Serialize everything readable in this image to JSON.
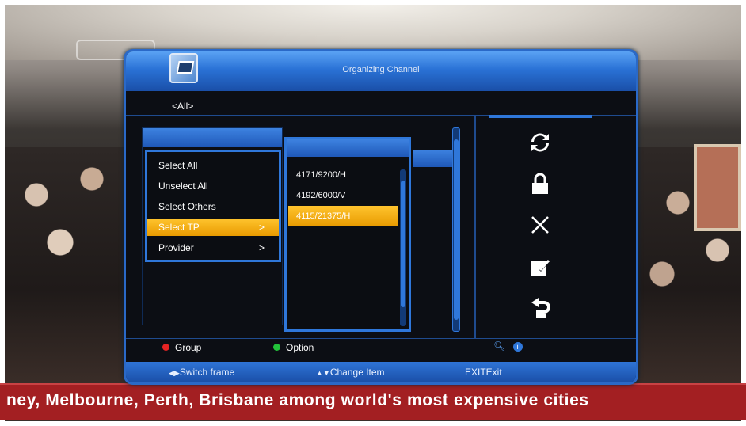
{
  "dialog": {
    "title": "Organizing Channel",
    "group": "<All>"
  },
  "options_menu": {
    "items": [
      {
        "label": "Select All",
        "arrow": ""
      },
      {
        "label": "Unselect All",
        "arrow": ""
      },
      {
        "label": "Select Others",
        "arrow": ""
      },
      {
        "label": "Select TP",
        "arrow": ">"
      },
      {
        "label": "Provider",
        "arrow": ">"
      }
    ],
    "selected_index": 3
  },
  "tp_list": {
    "items": [
      "4171/9200/H",
      "4192/6000/V",
      "4115/21375/H"
    ],
    "selected_index": 2
  },
  "side_icons": [
    "refresh-icon",
    "lock-icon",
    "delete-icon",
    "edit-icon",
    "move-icon"
  ],
  "hints": {
    "row1": [
      {
        "color": "#e62323",
        "label": "Group"
      },
      {
        "color": "#22c13a",
        "label": "Option"
      }
    ],
    "row2": [
      {
        "glyph": "◀▶",
        "label": "Switch frame"
      },
      {
        "glyph": "▲▼",
        "label": "Change Item"
      },
      {
        "glyph": "",
        "label": "EXITExit"
      }
    ]
  },
  "ticker": {
    "text": "ney, Melbourne, Perth, Brisbane among world's most expensive cities"
  }
}
